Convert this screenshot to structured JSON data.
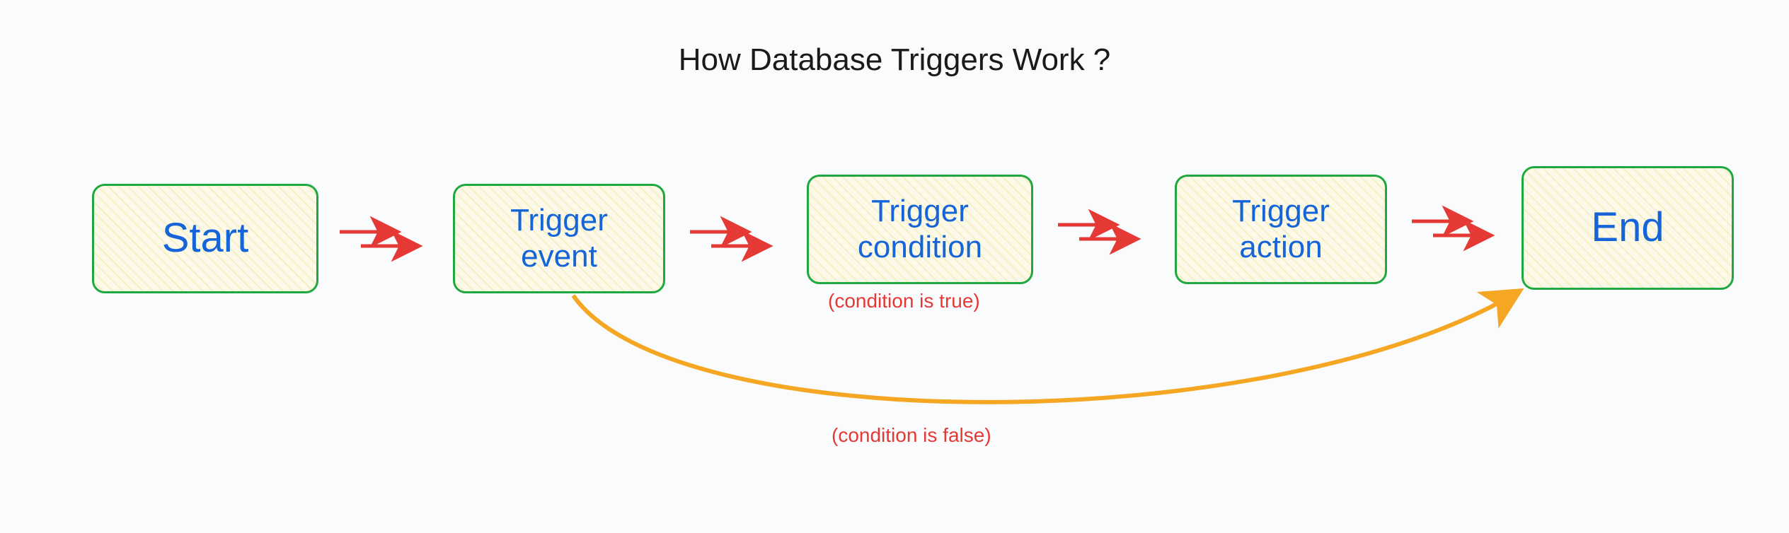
{
  "title": "How Database Triggers Work ?",
  "nodes": {
    "start": "Start",
    "event_l1": "Trigger",
    "event_l2": "event",
    "condition_l1": "Trigger",
    "condition_l2": "condition",
    "action_l1": "Trigger",
    "action_l2": "action",
    "end": "End"
  },
  "annotations": {
    "true": "(condition is true)",
    "false": "(condition is false)"
  },
  "colors": {
    "node_border": "#1fa840",
    "node_text": "#1565d8",
    "arrow_main": "#e53935",
    "arrow_bypass": "#f5a623",
    "title": "#1a1a1a"
  }
}
